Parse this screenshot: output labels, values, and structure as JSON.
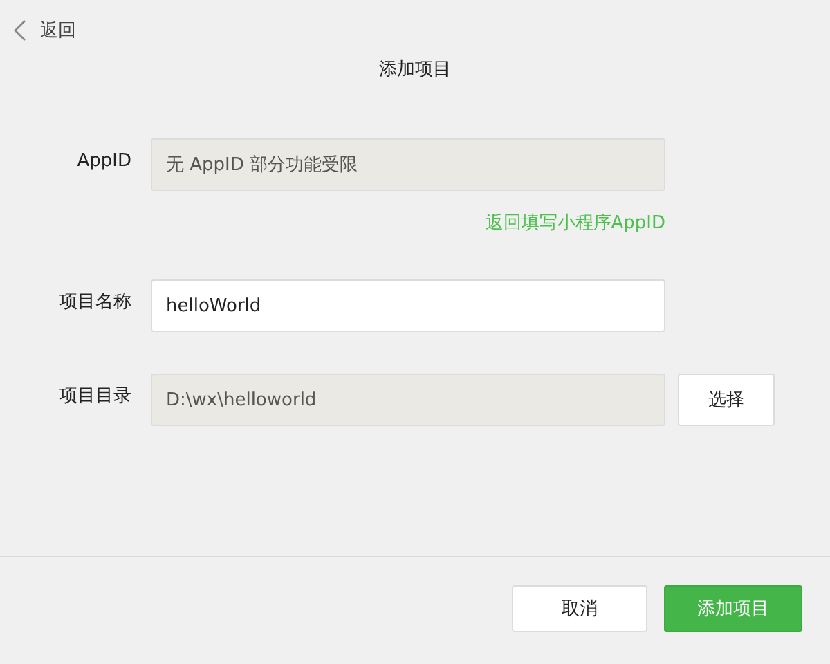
{
  "back": {
    "label": "返回"
  },
  "title": "添加项目",
  "fields": [
    {
      "label": "AppID",
      "value": "无 AppID 部分功能受限",
      "disabled": true,
      "link": "返回填写小程序AppID"
    },
    {
      "label": "项目名称",
      "value": "helloWorld",
      "disabled": false
    },
    {
      "label": "项目目录",
      "value": "D:\\wx\\helloworld",
      "disabled": true,
      "button": "选择"
    }
  ],
  "buttons": [
    {
      "label": "取消",
      "kind": "secondary"
    },
    {
      "label": "添加项目",
      "kind": "primary"
    }
  ]
}
